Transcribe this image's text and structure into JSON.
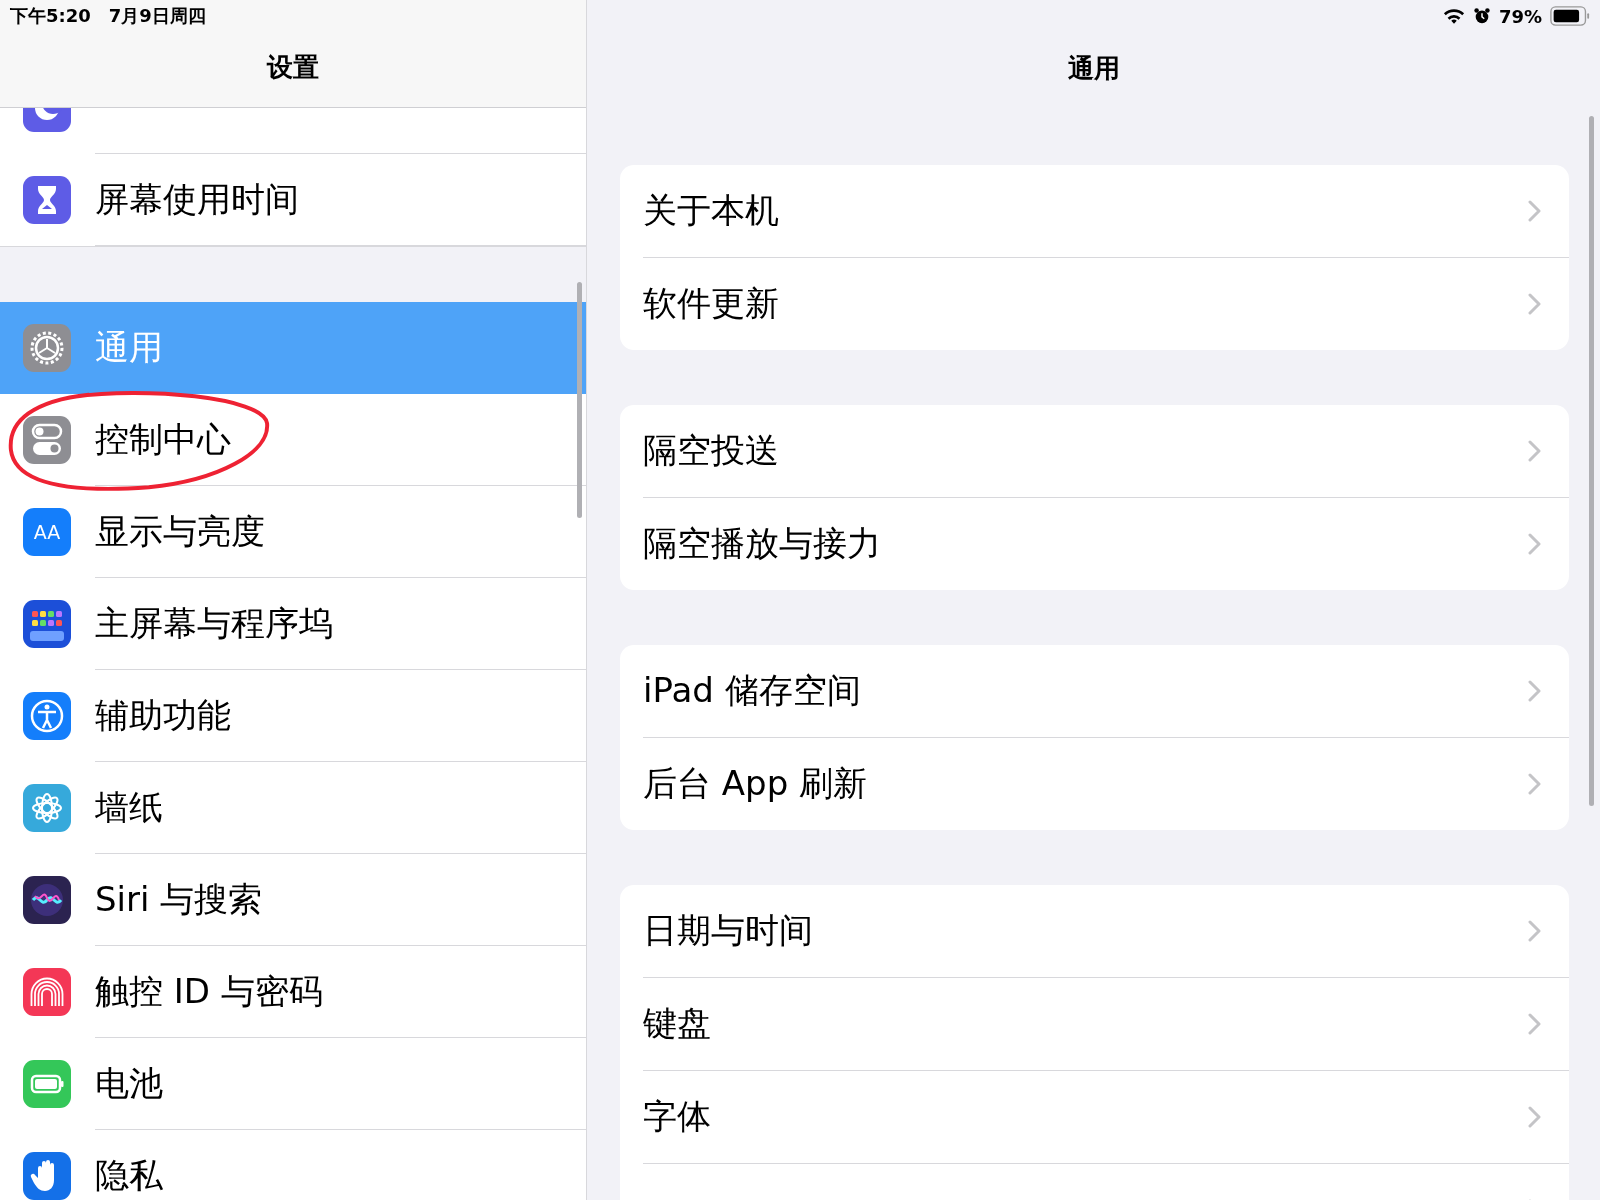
{
  "status_bar": {
    "time": "下午5:20",
    "date": "7月9日周四",
    "battery_percent": "79%"
  },
  "sidebar": {
    "title": "设置",
    "groups": [
      [
        {
          "kind": "moon",
          "color": "#5e5ce6",
          "selected": false
        },
        {
          "label": "屏幕使用时间",
          "kind": "hourglass",
          "color": "#5e5ce6",
          "selected": false
        }
      ],
      [
        {
          "label": "通用",
          "kind": "gear",
          "color": "#8e8e93",
          "selected": true
        },
        {
          "label": "控制中心",
          "kind": "toggles",
          "color": "#8e8e93",
          "selected": false
        },
        {
          "label": "显示与亮度",
          "kind": "textsize",
          "color": "#147efb",
          "selected": false,
          "icon_label": "AA"
        },
        {
          "label": "主屏幕与程序坞",
          "kind": "grid",
          "color": "#1c4fd8",
          "selected": false
        },
        {
          "label": "辅助功能",
          "kind": "accessibility",
          "color": "#147efb",
          "selected": false
        },
        {
          "label": "墙纸",
          "kind": "flower",
          "color": "#36a9db",
          "selected": false
        },
        {
          "label": "Siri 与搜索",
          "kind": "orb",
          "color": "#2b2350",
          "selected": false
        },
        {
          "label": "触控 ID 与密码",
          "kind": "fingerprint",
          "color": "#f43756",
          "selected": false
        },
        {
          "label": "电池",
          "kind": "battery",
          "color": "#34c759",
          "selected": false
        },
        {
          "label": "隐私",
          "kind": "hand",
          "color": "#1470e8",
          "selected": false
        }
      ]
    ]
  },
  "detail": {
    "title": "通用",
    "groups": [
      [
        "关于本机",
        "软件更新"
      ],
      [
        "隔空投送",
        "隔空播放与接力"
      ],
      [
        "iPad 储存空间",
        "后台 App 刷新"
      ],
      [
        "日期与时间",
        "键盘",
        "字体"
      ]
    ],
    "more_below": true
  }
}
